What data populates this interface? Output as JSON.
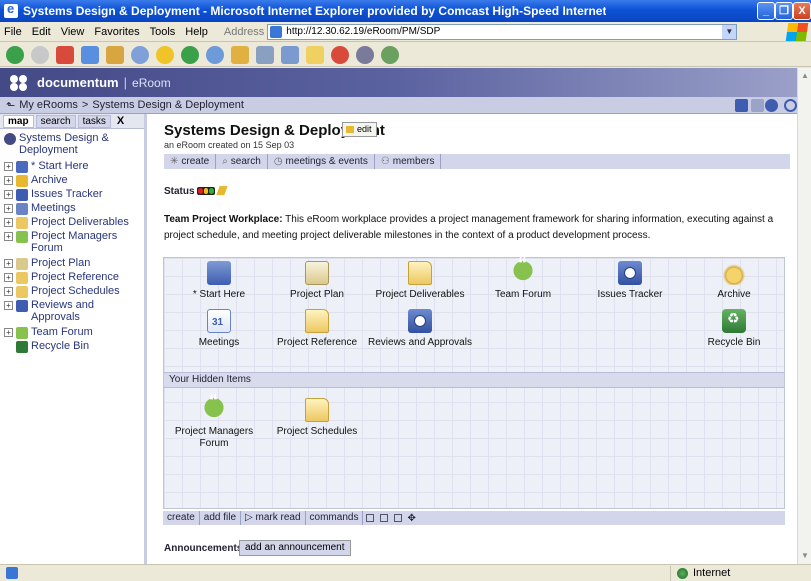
{
  "window": {
    "title": "Systems Design & Deployment - Microsoft Internet Explorer provided by Comcast High-Speed Internet",
    "minimize": "_",
    "maximize": "❐",
    "close": "X"
  },
  "menu": {
    "items": [
      "File",
      "Edit",
      "View",
      "Favorites",
      "Tools",
      "Help"
    ],
    "address_label": "Address",
    "address_value": "http://12.30.62.19/eRoom/PM/SDP"
  },
  "banner": {
    "brand": "documentum",
    "separator": "|",
    "product": "eRoom"
  },
  "breadcrumb": {
    "arrow": "⬑",
    "root": "My eRooms",
    "sep": ">",
    "current": "Systems Design & Deployment"
  },
  "left_tabs": {
    "map": "map",
    "search": "search",
    "tasks": "tasks",
    "close": "X"
  },
  "tree": {
    "root": "Systems Design & Deployment",
    "items": [
      {
        "label": "* Start Here",
        "exp": "+",
        "color": "#4a6ac0"
      },
      {
        "label": "Archive",
        "exp": "+",
        "color": "#e8b830"
      },
      {
        "label": "Issues Tracker",
        "exp": "+",
        "color": "#3e5db0"
      },
      {
        "label": "Meetings",
        "exp": "+",
        "color": "#6b84c4"
      },
      {
        "label": "Project Deliverables",
        "exp": "+",
        "color": "#ecc862"
      },
      {
        "label": "Project Managers Forum",
        "exp": "+",
        "color": "#88c24e"
      },
      {
        "label": "Project Plan",
        "exp": "+",
        "color": "#dbc98c"
      },
      {
        "label": "Project Reference",
        "exp": "+",
        "color": "#ecc862"
      },
      {
        "label": "Project Schedules",
        "exp": "+",
        "color": "#ecc862"
      },
      {
        "label": "Reviews and Approvals",
        "exp": "+",
        "color": "#3e5db0"
      },
      {
        "label": "Team Forum",
        "exp": "+",
        "color": "#88c24e"
      },
      {
        "label": "Recycle Bin",
        "exp": "",
        "color": "#2e7a36"
      }
    ]
  },
  "room": {
    "title": "Systems Design & Deployment",
    "edit": "edit",
    "created": "an eRoom created on 15 Sep 03",
    "actions": [
      {
        "icon": "✳",
        "label": "create"
      },
      {
        "icon": "⌕",
        "label": "search"
      },
      {
        "icon": "◷",
        "label": "meetings & events"
      },
      {
        "icon": "⚇",
        "label": "members"
      }
    ],
    "status_label": "Status",
    "status_colors": [
      "#e02020",
      "#f0c020",
      "#30b030"
    ],
    "description_bold": "Team Project Workplace:",
    "description": " This eRoom workplace provides a project management framework for sharing information, executing against a project schedule, and meeting project deliverable milestones in the context of a product development process."
  },
  "items": [
    {
      "label": "* Start Here",
      "icon": "cal"
    },
    {
      "label": "Project Plan",
      "icon": "doc"
    },
    {
      "label": "Project Deliverables",
      "icon": "folder"
    },
    {
      "label": "Team Forum",
      "icon": "forum"
    },
    {
      "label": "Issues Tracker",
      "icon": "clock"
    },
    {
      "label": "Archive",
      "icon": "archive"
    },
    {
      "label": "Meetings",
      "icon": "cal31"
    },
    {
      "label": "Project Reference",
      "icon": "folder"
    },
    {
      "label": "Reviews and Approvals",
      "icon": "clock"
    },
    {
      "label": "Recycle Bin",
      "icon": "recycle"
    }
  ],
  "hidden": {
    "header": "Your Hidden Items",
    "items": [
      {
        "label": "Project Managers Forum",
        "icon": "forum"
      },
      {
        "label": "Project Schedules",
        "icon": "folder"
      }
    ]
  },
  "commands": {
    "create": "create",
    "add_file": "add file",
    "mark_read": "▷ mark read",
    "commands": "commands",
    "settings": "✥"
  },
  "announcements": {
    "label": "Announcements",
    "button": "add an announcement"
  },
  "statusbar": {
    "zone": "Internet"
  }
}
